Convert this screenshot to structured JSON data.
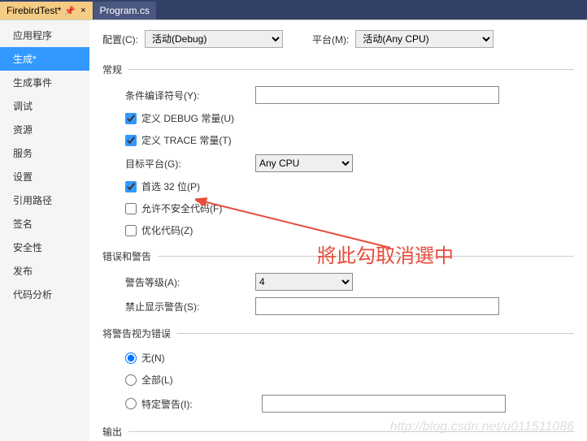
{
  "tabs": [
    {
      "label": "FirebirdTest*",
      "active": true
    },
    {
      "label": "Program.cs",
      "active": false
    }
  ],
  "sidebar": {
    "items": [
      {
        "label": "应用程序"
      },
      {
        "label": "生成*"
      },
      {
        "label": "生成事件"
      },
      {
        "label": "调试"
      },
      {
        "label": "资源"
      },
      {
        "label": "服务"
      },
      {
        "label": "设置"
      },
      {
        "label": "引用路径"
      },
      {
        "label": "签名"
      },
      {
        "label": "安全性"
      },
      {
        "label": "发布"
      },
      {
        "label": "代码分析"
      }
    ],
    "active_index": 1
  },
  "top": {
    "config_label": "配置(C):",
    "config_value": "活动(Debug)",
    "platform_label": "平台(M):",
    "platform_value": "活动(Any CPU)"
  },
  "sections": {
    "general": "常规",
    "errors_warnings": "错误和警告",
    "treat_as_error": "将警告视为错误",
    "output": "输出"
  },
  "general": {
    "cond_symbols_label": "条件编译符号(Y):",
    "cond_symbols_value": "",
    "define_debug": "定义 DEBUG 常量(U)",
    "define_trace": "定义 TRACE 常量(T)",
    "target_platform_label": "目标平台(G):",
    "target_platform_value": "Any CPU",
    "prefer_32bit": "首选 32 位(P)",
    "allow_unsafe": "允许不安全代码(F)",
    "optimize": "优化代码(Z)"
  },
  "warnings": {
    "level_label": "警告等级(A):",
    "level_value": "4",
    "suppress_label": "禁止显示警告(S):",
    "suppress_value": ""
  },
  "treat": {
    "none": "无(N)",
    "all": "全部(L)",
    "specific": "特定警告(I):",
    "specific_value": ""
  },
  "annotation_text": "將此勾取消選中",
  "watermark": "http://blog.csdn.net/u011511086"
}
